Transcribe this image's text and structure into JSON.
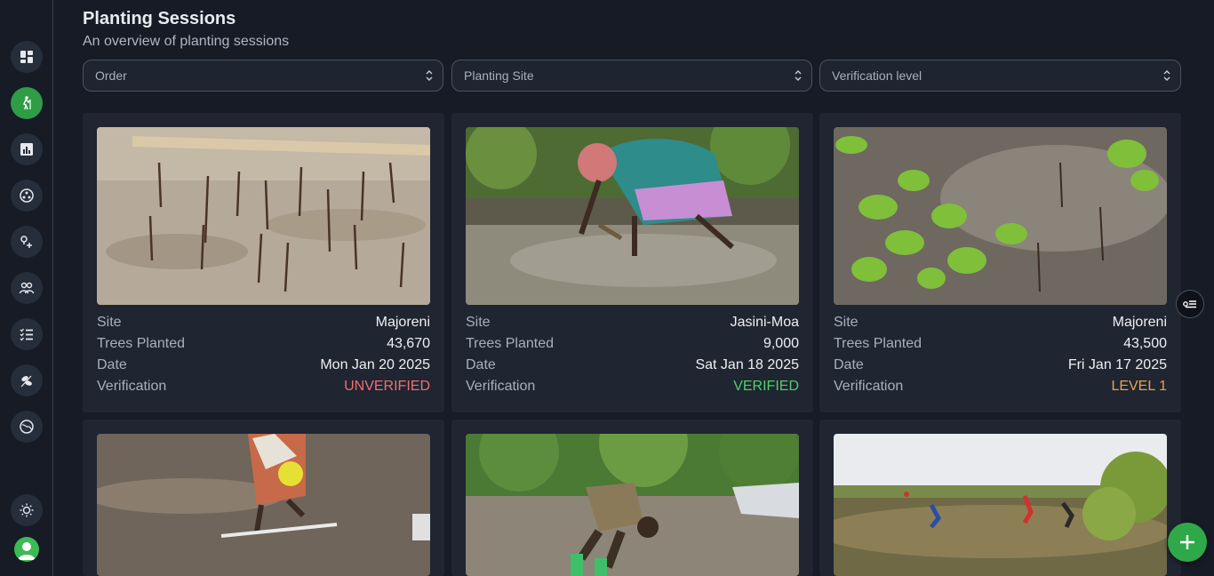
{
  "header": {
    "title": "Planting Sessions",
    "subtitle": "An overview of planting sessions"
  },
  "filters": [
    {
      "label": "Order"
    },
    {
      "label": "Planting Site"
    },
    {
      "label": "Verification level"
    }
  ],
  "sidebar": {
    "items": [
      {
        "icon": "dashboard-icon"
      },
      {
        "icon": "planting-icon",
        "active": true
      },
      {
        "icon": "reports-icon"
      },
      {
        "icon": "organization-icon"
      },
      {
        "icon": "sites-icon"
      },
      {
        "icon": "people-icon"
      },
      {
        "icon": "tasks-list-icon"
      },
      {
        "icon": "species-icon"
      },
      {
        "icon": "globe-icon"
      }
    ],
    "theme_toggle_icon": "sun-icon",
    "avatar_icon": "user-avatar-icon"
  },
  "labels": {
    "site": "Site",
    "trees": "Trees Planted",
    "date": "Date",
    "verification": "Verification"
  },
  "sessions": [
    {
      "site": "Majoreni",
      "trees": "43,670",
      "date": "Mon Jan 20 2025",
      "verification": "UNVERIFIED",
      "status_color": "#f06f6f"
    },
    {
      "site": "Jasini-Moa",
      "trees": "9,000",
      "date": "Sat Jan 18 2025",
      "verification": "VERIFIED",
      "status_color": "#4fcf6c"
    },
    {
      "site": "Majoreni",
      "trees": "43,500",
      "date": "Fri Jan 17 2025",
      "verification": "LEVEL 1",
      "status_color": "#f0a04b"
    },
    {},
    {},
    {}
  ],
  "colors": {
    "accent": "#2e9d46",
    "background": "#161b26",
    "card": "#1f2531"
  }
}
